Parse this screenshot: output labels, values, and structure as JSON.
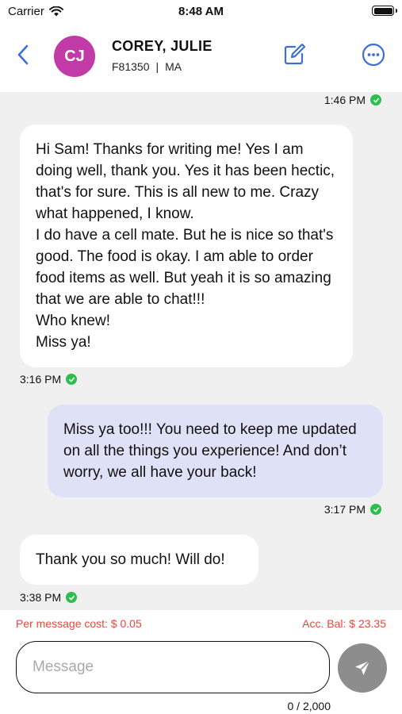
{
  "status_bar": {
    "carrier": "Carrier",
    "time": "8:48 AM"
  },
  "header": {
    "avatar_initials": "CJ",
    "avatar_color": "#c13aa7",
    "name": "COREY, JULIE",
    "id": "F81350",
    "separator": "|",
    "state": "MA",
    "icons": [
      "chevron-left-icon",
      "compose-icon",
      "more-icon"
    ],
    "accent_color": "#3d6fd8"
  },
  "messages": [
    {
      "direction": "out",
      "time": "1:46 PM",
      "status": "delivered"
    },
    {
      "direction": "in",
      "text": "Hi Sam! Thanks for writing me! Yes I am doing well, thank you. Yes it has been hectic, that's for sure. This is all new to me. Crazy what happened, I know.\nI do have a cell mate. But he is nice so that's good. The food is okay. I am able to order food items as well. But yeah it is so amazing that we are able to chat!!!\nWho knew!\nMiss ya!",
      "time": "3:16 PM",
      "status": "delivered"
    },
    {
      "direction": "out",
      "text": "Miss ya too!!! You need to keep me updated on all the things you experience! And don’t worry, we all have your back!",
      "time": "3:17 PM",
      "status": "delivered"
    },
    {
      "direction": "in",
      "text": "Thank you so much! Will do!",
      "time": "3:38 PM",
      "status": "delivered"
    }
  ],
  "footer": {
    "cost_label": "Per message cost: $ 0.05",
    "balance_label": "Acc. Bal: $ 23.35",
    "input_placeholder": "Message",
    "input_value": "",
    "char_counter": "0 / 2,000",
    "alert_color": "#e8473d",
    "send_color": "#8d8d8d"
  }
}
